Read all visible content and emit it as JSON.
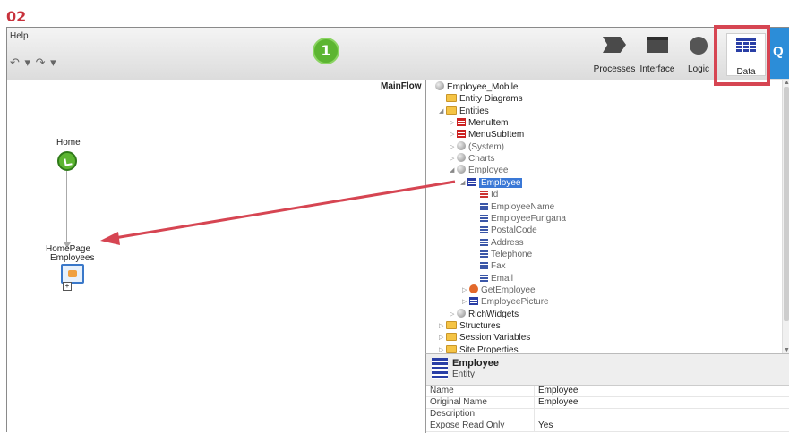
{
  "step_label": "02",
  "menu": {
    "help": "Help"
  },
  "toolbar": {
    "undo_glyph": "↶ ▾ ↷ ▾",
    "step_badge": "1",
    "tabs": [
      {
        "label": "Processes",
        "icon": "processes-icon"
      },
      {
        "label": "Interface",
        "icon": "interface-icon"
      },
      {
        "label": "Logic",
        "icon": "logic-icon"
      },
      {
        "label": "Data",
        "icon": "data-icon",
        "selected": true
      }
    ],
    "search_glyph": "Q"
  },
  "canvas": {
    "flow_label": "MainFlow",
    "nodes": [
      {
        "label": "Home",
        "icon": "start-node-icon"
      },
      {
        "label": "HomePage",
        "sublabel": "Employees",
        "icon": "web-screen-icon"
      }
    ]
  },
  "tree": {
    "items": [
      {
        "label": "Employee_Mobile",
        "icon": "globe-icon",
        "expander": ""
      },
      {
        "label": "Entity Diagrams",
        "icon": "folder-icon",
        "expander": ""
      },
      {
        "label": "Entities",
        "icon": "folder-icon",
        "expander": "◢"
      },
      {
        "label": "MenuItem",
        "icon": "entity-icon",
        "expander": "▷"
      },
      {
        "label": "MenuSubItem",
        "icon": "entity-icon",
        "expander": "▷"
      },
      {
        "label": "(System)",
        "icon": "globe-icon",
        "expander": "▷",
        "muted": true
      },
      {
        "label": "Charts",
        "icon": "globe-icon",
        "expander": "▷",
        "muted": true
      },
      {
        "label": "Employee",
        "icon": "globe-icon",
        "expander": "◢",
        "muted": true
      },
      {
        "label": "Employee",
        "icon": "entity-icon",
        "expander": "◢",
        "selected": true
      },
      {
        "label": "Id",
        "icon": "key-attribute-icon",
        "muted": true
      },
      {
        "label": "EmployeeName",
        "icon": "attribute-icon",
        "muted": true
      },
      {
        "label": "EmployeeFurigana",
        "icon": "attribute-icon",
        "muted": true
      },
      {
        "label": "PostalCode",
        "icon": "attribute-icon",
        "muted": true
      },
      {
        "label": "Address",
        "icon": "attribute-icon",
        "muted": true
      },
      {
        "label": "Telephone",
        "icon": "attribute-icon",
        "muted": true
      },
      {
        "label": "Fax",
        "icon": "attribute-icon",
        "muted": true
      },
      {
        "label": "Email",
        "icon": "attribute-icon",
        "muted": true
      },
      {
        "label": "GetEmployee",
        "icon": "action-icon",
        "expander": "▷",
        "muted": true
      },
      {
        "label": "EmployeePicture",
        "icon": "entity-icon",
        "expander": "▷",
        "muted": true
      },
      {
        "label": "RichWidgets",
        "icon": "globe-icon",
        "expander": "▷"
      },
      {
        "label": "Structures",
        "icon": "folder-icon",
        "expander": "▷"
      },
      {
        "label": "Session Variables",
        "icon": "folder-icon",
        "expander": "▷"
      },
      {
        "label": "Site Properties",
        "icon": "folder-icon",
        "expander": "▷"
      }
    ]
  },
  "properties": {
    "title": "Employee",
    "subtitle": "Entity",
    "rows": [
      {
        "key": "Name",
        "value": "Employee"
      },
      {
        "key": "Original Name",
        "value": "Employee"
      },
      {
        "key": "Description",
        "value": ""
      },
      {
        "key": "Expose Read Only",
        "value": "Yes"
      }
    ]
  },
  "colors": {
    "annotation_red": "#d64552",
    "step_green": "#5cb531",
    "selection_blue": "#3a78d6",
    "search_blue": "#2c8dd8"
  }
}
